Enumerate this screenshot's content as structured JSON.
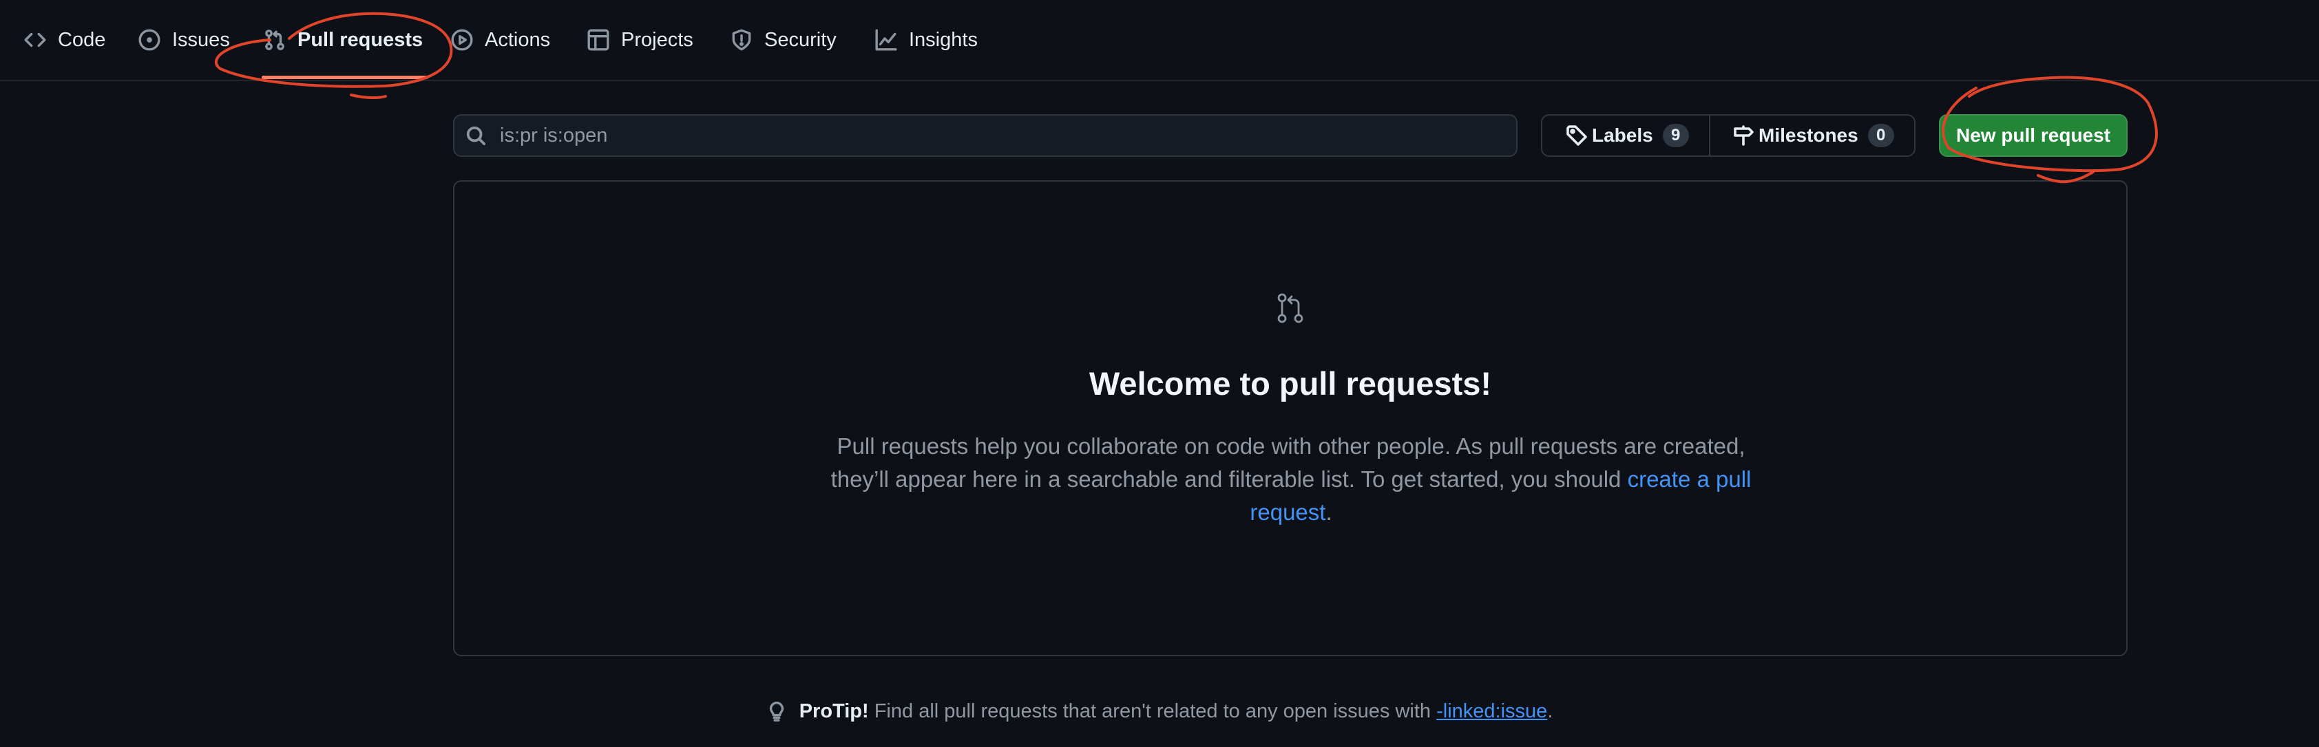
{
  "nav": {
    "tabs": [
      {
        "label": "Code",
        "icon": "code-icon"
      },
      {
        "label": "Issues",
        "icon": "issue-circle-icon"
      },
      {
        "label": "Pull requests",
        "icon": "pull-request-icon",
        "active": true
      },
      {
        "label": "Actions",
        "icon": "play-icon"
      },
      {
        "label": "Projects",
        "icon": "table-icon"
      },
      {
        "label": "Security",
        "icon": "shield-icon"
      },
      {
        "label": "Insights",
        "icon": "graph-icon"
      }
    ]
  },
  "filter": {
    "search_value": "is:pr is:open",
    "labels_label": "Labels",
    "labels_count": "9",
    "milestones_label": "Milestones",
    "milestones_count": "0",
    "new_pr_label": "New pull request"
  },
  "blankslate": {
    "title": "Welcome to pull requests!",
    "description": "Pull requests help you collaborate on code with other people. As pull requests are created, they’ll appear here in a searchable and filterable list. To get started, you should",
    "link_text": "create a pull request",
    "trailing": "."
  },
  "protip": {
    "strong": "ProTip!",
    "text": "Find all pull requests that aren't related to any open issues with",
    "link": "-linked:issue",
    "trailing": "."
  },
  "colors": {
    "background": "#0d1117",
    "accent_underline": "#f78166",
    "primary_button": "#238636",
    "link": "#4493f8",
    "annotation": "#e0442a"
  }
}
